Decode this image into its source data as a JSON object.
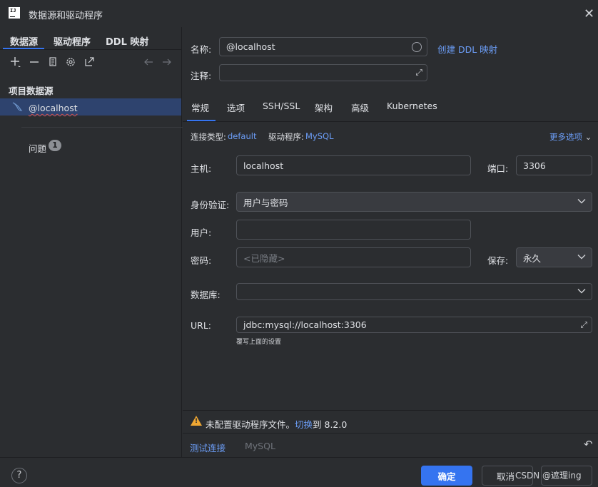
{
  "window": {
    "title": "数据源和驱动程序",
    "close_glyph": "✕",
    "logo_text": "IJ"
  },
  "left_panel": {
    "tabs": [
      "数据源",
      "驱动程序",
      "DDL 映射"
    ],
    "active_tab": "数据源",
    "section_title": "项目数据源",
    "selected_item": "@localhost",
    "problems_label": "问题",
    "problems_count": "1",
    "toolbar_icons": [
      "add-icon",
      "remove-icon",
      "copy-icon",
      "settings-icon",
      "open-external-icon",
      "back-arrow-icon",
      "forward-arrow-icon"
    ]
  },
  "form": {
    "name_label": "名称:",
    "name_value": "@localhost",
    "create_ddl_link": "创建 DDL 映射",
    "comment_label": "注释:",
    "tabs": [
      "常规",
      "选项",
      "SSH/SSL",
      "架构",
      "高级",
      "Kubernetes"
    ],
    "active_tab": "常规",
    "connection_type_label": "连接类型:",
    "connection_type_value": "default",
    "driver_label": "驱动程序:",
    "driver_value": "MySQL",
    "more_options": "更多选项",
    "host_label": "主机:",
    "host_value": "localhost",
    "port_label": "端口:",
    "port_value": "3306",
    "auth_label": "身份验证:",
    "auth_value": "用户与密码",
    "user_label": "用户:",
    "password_label": "密码:",
    "password_placeholder": "<已隐藏>",
    "save_label": "保存:",
    "save_value": "永久",
    "database_label": "数据库:",
    "url_label": "URL:",
    "url_value": "jdbc:mysql://localhost:3306",
    "url_hint": "覆写上面的设置"
  },
  "warning": {
    "text": "未配置驱动程序文件。",
    "link": "切换",
    "suffix": "到 8.2.0"
  },
  "bottom_actions": {
    "test_connection": "测试连接",
    "driver_name": "MySQL",
    "revert_glyph": "↶"
  },
  "footer": {
    "help_glyph": "?",
    "ok_button": "确定",
    "cancel_button": "取消",
    "watermark": "CSDN @遮理ing"
  },
  "colors": {
    "accent": "#3574f0",
    "link": "#6c9ef8",
    "background": "#2b2d30",
    "selection": "#2e436e",
    "warning": "#f0a732"
  }
}
